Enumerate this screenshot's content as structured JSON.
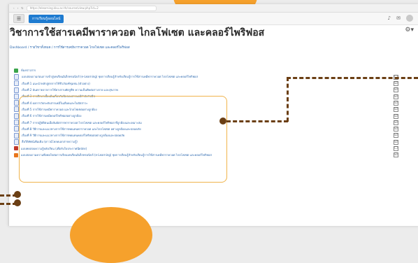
{
  "browser": {
    "url": "https://elearning.kku.ac.th/course/view.php?id=2",
    "tab_text": "home page"
  },
  "navbar": {
    "home_label": "การเรียนรู้ออนไลน์"
  },
  "course": {
    "title": "วิชาการใช้สารเคมีพาราควอต ไกลโฟเซต และคลอร์ไพริฟอส",
    "breadcrumb": "Dashboard / รายวิชาทั้งหมด / การใช้สารเคมีพาราควอต ไกลโฟเซต และคลอร์ไพริฟอส"
  },
  "activities": [
    {
      "icon": "forum",
      "label": "ห้องข่าวสาร",
      "checkbox": ""
    },
    {
      "icon": "page",
      "label": "แบบสอบถามก่อนการเข้าสู่บทเรียนอิเล็กทรอนิกส์ (e-Learning) ชุดการเรียนรู้สำหรับเรียนรู้การใช้สารเคมีพาราควอต ไกลโฟเซต และคลอร์ไพริฟอส",
      "checkbox": "☐"
    },
    {
      "icon": "page",
      "label": "เรื่องที่ 1 แนะนำหลักสูตรการใช้ชีวภัณฑ์ชุมชน (ตัวอย่าง)",
      "checkbox": "☑"
    },
    {
      "icon": "page",
      "label": "เรื่องที่ 2 อันตรายจากการใช้ยาปราบศัตรูพืช ความเป็นพิษต่อร่างกาย และสุขภาพ",
      "checkbox": "☑"
    },
    {
      "icon": "page",
      "label": "เรื่องที่ 3 การศึกษาเบื้องต้นเกี่ยวกับพิษของสารเคมีกำจัดวัชพืช",
      "checkbox": "☑"
    },
    {
      "icon": "page",
      "label": "เรื่องที่ 4 ผลการวัดระดับสารเคมีในเลือดและในปัสสาวะ",
      "checkbox": "☑"
    },
    {
      "icon": "page",
      "label": "เรื่องที่ 5 การใช้สารเคมีพาราควอต และไกลโฟเซตอย่างถูกต้อง",
      "checkbox": "☑"
    },
    {
      "icon": "page",
      "label": "เรื่องที่ 6 การใช้สารเคมีคลอร์ไพริฟอสอย่างถูกต้อง",
      "checkbox": "☑"
    },
    {
      "icon": "page",
      "label": "เรื่องที่ 7 การปฏิบัติตนเมื่อสัมผัสสารพาราควอต ไกลโฟเซต และคลอร์ไพริฟอส ที่ถูกต้องและเหมาะสม",
      "checkbox": "☑"
    },
    {
      "icon": "page",
      "label": "เรื่องที่ 8 วิธีการและแนวทางการใช้สารทดแทนพาราควอต และไกลโฟเซต อย่างถูกต้องและปลอดภัย",
      "checkbox": "☑"
    },
    {
      "icon": "page",
      "label": "เรื่องที่ 9 วิธีการและแนวทางการใช้สารทดแทนคลอร์ไพริฟอสอย่างถูกต้องและปลอดภัย",
      "checkbox": "☑"
    },
    {
      "icon": "page",
      "label": "สื่อวีดิทัศน์เพิ่มเติม (ดาวน์โหลดเอกสารความรู้)",
      "checkbox": "☑"
    },
    {
      "icon": "quiz",
      "label": "แบบทดสอบความรู้หลังเรียน (เพื่อรับใบประกาศนียบัตร)",
      "checkbox": "☐"
    },
    {
      "icon": "survey",
      "label": "แบบสอบถามความพึงพอใจต่อการเรียนบทเรียนอิเล็กทรอนิกส์ (e-Learning) ชุดการเรียนรู้สำหรับเรียนรู้การใช้สารเคมีพาราควอต ไกลโฟเซต และคลอร์ไพริฟอส",
      "checkbox": "☑"
    }
  ]
}
